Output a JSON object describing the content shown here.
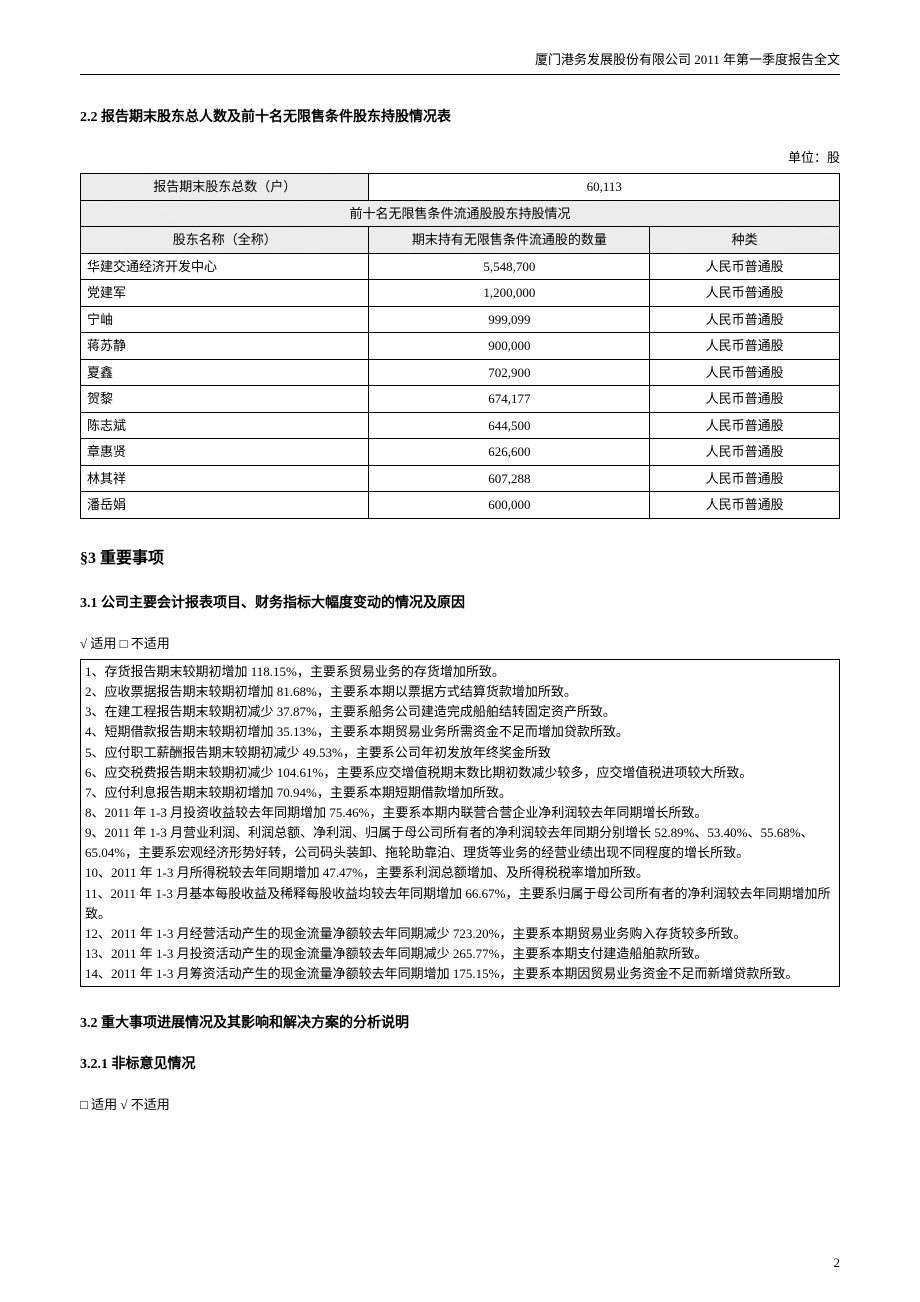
{
  "header": "厦门港务发展股份有限公司 2011 年第一季度报告全文",
  "section_2_2_title": "2.2 报告期末股东总人数及前十名无限售条件股东持股情况表",
  "unit": "单位：股",
  "table": {
    "total_label": "报告期末股东总数（户）",
    "total_value": "60,113",
    "top10_header": "前十名无限售条件流通股股东持股情况",
    "col_name": "股东名称（全称）",
    "col_shares": "期末持有无限售条件流通股的数量",
    "col_type": "种类",
    "rows": [
      {
        "name": "华建交通经济开发中心",
        "shares": "5,548,700",
        "type": "人民币普通股"
      },
      {
        "name": "党建军",
        "shares": "1,200,000",
        "type": "人民币普通股"
      },
      {
        "name": "宁岫",
        "shares": "999,099",
        "type": "人民币普通股"
      },
      {
        "name": "蒋苏静",
        "shares": "900,000",
        "type": "人民币普通股"
      },
      {
        "name": "夏鑫",
        "shares": "702,900",
        "type": "人民币普通股"
      },
      {
        "name": "贺黎",
        "shares": "674,177",
        "type": "人民币普通股"
      },
      {
        "name": "陈志斌",
        "shares": "644,500",
        "type": "人民币普通股"
      },
      {
        "name": "章惠贤",
        "shares": "626,600",
        "type": "人民币普通股"
      },
      {
        "name": "林其祥",
        "shares": "607,288",
        "type": "人民币普通股"
      },
      {
        "name": "潘岳娟",
        "shares": "600,000",
        "type": "人民币普通股"
      }
    ]
  },
  "section_3_title": "§3  重要事项",
  "section_3_1_title": "3.1 公司主要会计报表项目、财务指标大幅度变动的情况及原因",
  "applicability_3_1": "√ 适用 □ 不适用",
  "reasons": [
    "1、存货报告期末较期初增加 118.15%，主要系贸易业务的存货增加所致。",
    "2、应收票据报告期末较期初增加 81.68%，主要系本期以票据方式结算货款增加所致。",
    "3、在建工程报告期末较期初减少 37.87%，主要系船务公司建造完成船舶结转固定资产所致。",
    "4、短期借款报告期末较期初增加 35.13%，主要系本期贸易业务所需资金不足而增加贷款所致。",
    "5、应付职工薪酬报告期末较期初减少 49.53%，主要系公司年初发放年终奖金所致",
    "6、应交税费报告期末较期初减少 104.61%，主要系应交增值税期末数比期初数减少较多，应交增值税进项较大所致。",
    "7、应付利息报告期末较期初增加 70.94%，主要系本期短期借款增加所致。",
    "8、2011 年 1-3 月投资收益较去年同期增加 75.46%，主要系本期内联营合营企业净利润较去年同期增长所致。",
    "9、2011 年 1-3 月营业利润、利润总额、净利润、归属于母公司所有者的净利润较去年同期分别增长 52.89%、53.40%、55.68%、65.04%，主要系宏观经济形势好转，公司码头装卸、拖轮助靠泊、理货等业务的经营业绩出现不同程度的增长所致。",
    "10、2011 年 1-3 月所得税较去年同期增加 47.47%，主要系利润总额增加、及所得税税率增加所致。",
    "11、2011 年 1-3 月基本每股收益及稀释每股收益均较去年同期增加 66.67%，主要系归属于母公司所有者的净利润较去年同期增加所致。",
    "12、2011 年 1-3 月经营活动产生的现金流量净额较去年同期减少 723.20%，主要系本期贸易业务购入存货较多所致。",
    "13、2011 年 1-3 月投资活动产生的现金流量净额较去年同期减少 265.77%，主要系本期支付建造船舶款所致。",
    "14、2011 年 1-3 月筹资活动产生的现金流量净额较去年同期增加 175.15%，主要系本期因贸易业务资金不足而新增贷款所致。"
  ],
  "section_3_2_title": "3.2 重大事项进展情况及其影响和解决方案的分析说明",
  "section_3_2_1_title": "3.2.1 非标意见情况",
  "applicability_3_2_1": "□ 适用 √ 不适用",
  "page_number": "2"
}
